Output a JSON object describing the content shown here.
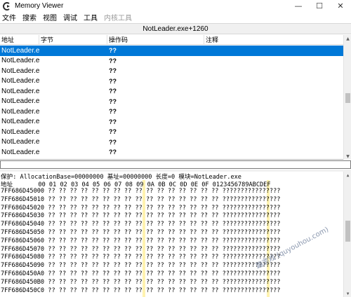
{
  "window": {
    "title": "Memory Viewer",
    "minimize_glyph": "—",
    "maximize_glyph": "☐",
    "close_glyph": "✕"
  },
  "menu": [
    {
      "label": "文件",
      "enabled": true
    },
    {
      "label": "搜索",
      "enabled": true
    },
    {
      "label": "视图",
      "enabled": true
    },
    {
      "label": "调试",
      "enabled": true
    },
    {
      "label": "工具",
      "enabled": true
    },
    {
      "label": "内核工具",
      "enabled": false
    }
  ],
  "address_header": "NotLeader.exe+1260",
  "disassembler": {
    "columns": {
      "address": "地址",
      "bytes": "字节",
      "opcode": "操作码",
      "comment": "注释"
    },
    "rows": [
      {
        "address": "NotLeader.e>",
        "bytes": "",
        "opcode": "??",
        "comment": "",
        "selected": true
      },
      {
        "address": "NotLeader.e>",
        "bytes": "",
        "opcode": "??",
        "comment": "",
        "selected": false
      },
      {
        "address": "NotLeader.e>",
        "bytes": "",
        "opcode": "??",
        "comment": "",
        "selected": false
      },
      {
        "address": "NotLeader.e>",
        "bytes": "",
        "opcode": "??",
        "comment": "",
        "selected": false
      },
      {
        "address": "NotLeader.e>",
        "bytes": "",
        "opcode": "??",
        "comment": "",
        "selected": false
      },
      {
        "address": "NotLeader.e>",
        "bytes": "",
        "opcode": "??",
        "comment": "",
        "selected": false
      },
      {
        "address": "NotLeader.e>",
        "bytes": "",
        "opcode": "??",
        "comment": "",
        "selected": false
      },
      {
        "address": "NotLeader.e>",
        "bytes": "",
        "opcode": "??",
        "comment": "",
        "selected": false
      },
      {
        "address": "NotLeader.e>",
        "bytes": "",
        "opcode": "??",
        "comment": "",
        "selected": false
      },
      {
        "address": "NotLeader.e>",
        "bytes": "",
        "opcode": "??",
        "comment": "",
        "selected": false
      },
      {
        "address": "NotLeader.e>",
        "bytes": "",
        "opcode": "??",
        "comment": "",
        "selected": false
      }
    ]
  },
  "hexview": {
    "info": "保护: AllocationBase=00000000 基址=00000000 长度=0 模块=NotLeader.exe",
    "column_header": "地址       00 01 02 03 04 05 06 07 08 09 0A 0B 0C 0D 0E 0F 0123456789ABCDEF",
    "rows": [
      {
        "address": "7FF686D45000",
        "bytes": "?? ?? ?? ?? ?? ?? ?? ?? ?? ?? ?? ?? ?? ?? ?? ??",
        "ascii": "????????????????"
      },
      {
        "address": "7FF686D45010",
        "bytes": "?? ?? ?? ?? ?? ?? ?? ?? ?? ?? ?? ?? ?? ?? ?? ??",
        "ascii": "????????????????"
      },
      {
        "address": "7FF686D45020",
        "bytes": "?? ?? ?? ?? ?? ?? ?? ?? ?? ?? ?? ?? ?? ?? ?? ??",
        "ascii": "????????????????"
      },
      {
        "address": "7FF686D45030",
        "bytes": "?? ?? ?? ?? ?? ?? ?? ?? ?? ?? ?? ?? ?? ?? ?? ??",
        "ascii": "????????????????"
      },
      {
        "address": "7FF686D45040",
        "bytes": "?? ?? ?? ?? ?? ?? ?? ?? ?? ?? ?? ?? ?? ?? ?? ??",
        "ascii": "????????????????"
      },
      {
        "address": "7FF686D45050",
        "bytes": "?? ?? ?? ?? ?? ?? ?? ?? ?? ?? ?? ?? ?? ?? ?? ??",
        "ascii": "????????????????"
      },
      {
        "address": "7FF686D45060",
        "bytes": "?? ?? ?? ?? ?? ?? ?? ?? ?? ?? ?? ?? ?? ?? ?? ??",
        "ascii": "????????????????"
      },
      {
        "address": "7FF686D45070",
        "bytes": "?? ?? ?? ?? ?? ?? ?? ?? ?? ?? ?? ?? ?? ?? ?? ??",
        "ascii": "????????????????"
      },
      {
        "address": "7FF686D45080",
        "bytes": "?? ?? ?? ?? ?? ?? ?? ?? ?? ?? ?? ?? ?? ?? ?? ??",
        "ascii": "????????????????"
      },
      {
        "address": "7FF686D45090",
        "bytes": "?? ?? ?? ?? ?? ?? ?? ?? ?? ?? ?? ?? ?? ?? ?? ??",
        "ascii": "????????????????"
      },
      {
        "address": "7FF686D450A0",
        "bytes": "?? ?? ?? ?? ?? ?? ?? ?? ?? ?? ?? ?? ?? ?? ?? ??",
        "ascii": "????????????????"
      },
      {
        "address": "7FF686D450B0",
        "bytes": "?? ?? ?? ?? ?? ?? ?? ?? ?? ?? ?? ?? ?? ?? ?? ??",
        "ascii": "????????????????"
      },
      {
        "address": "7FF686D450C0",
        "bytes": "?? ?? ?? ?? ?? ?? ?? ?? ?? ?? ?? ?? ?? ?? ?? ??",
        "ascii": "????????????????"
      }
    ]
  },
  "watermark": "趣游戏 (quyouhou.com)",
  "colors": {
    "selection": "#0078d7",
    "column_highlight": "#fff3b0"
  }
}
